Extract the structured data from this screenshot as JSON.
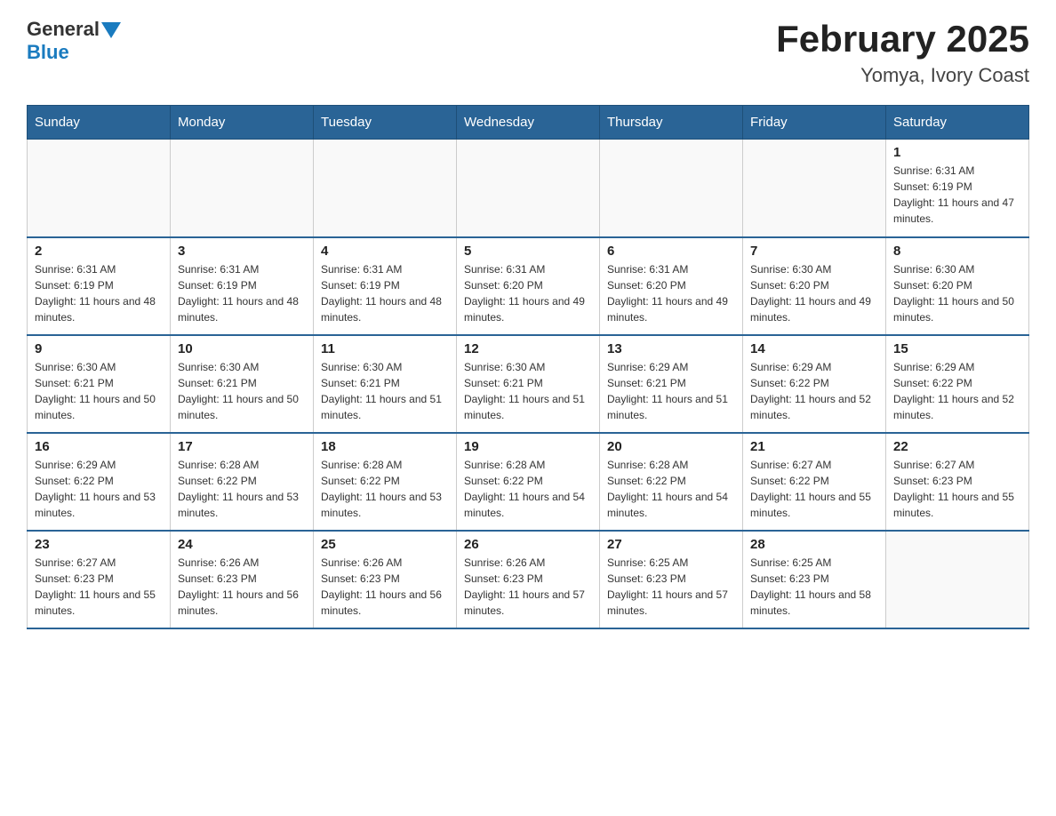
{
  "header": {
    "logo": {
      "general": "General",
      "arrow": "▲",
      "blue": "Blue"
    },
    "title": "February 2025",
    "location": "Yomya, Ivory Coast"
  },
  "weekdays": [
    "Sunday",
    "Monday",
    "Tuesday",
    "Wednesday",
    "Thursday",
    "Friday",
    "Saturday"
  ],
  "weeks": [
    [
      {
        "day": "",
        "info": ""
      },
      {
        "day": "",
        "info": ""
      },
      {
        "day": "",
        "info": ""
      },
      {
        "day": "",
        "info": ""
      },
      {
        "day": "",
        "info": ""
      },
      {
        "day": "",
        "info": ""
      },
      {
        "day": "1",
        "info": "Sunrise: 6:31 AM\nSunset: 6:19 PM\nDaylight: 11 hours and 47 minutes."
      }
    ],
    [
      {
        "day": "2",
        "info": "Sunrise: 6:31 AM\nSunset: 6:19 PM\nDaylight: 11 hours and 48 minutes."
      },
      {
        "day": "3",
        "info": "Sunrise: 6:31 AM\nSunset: 6:19 PM\nDaylight: 11 hours and 48 minutes."
      },
      {
        "day": "4",
        "info": "Sunrise: 6:31 AM\nSunset: 6:19 PM\nDaylight: 11 hours and 48 minutes."
      },
      {
        "day": "5",
        "info": "Sunrise: 6:31 AM\nSunset: 6:20 PM\nDaylight: 11 hours and 49 minutes."
      },
      {
        "day": "6",
        "info": "Sunrise: 6:31 AM\nSunset: 6:20 PM\nDaylight: 11 hours and 49 minutes."
      },
      {
        "day": "7",
        "info": "Sunrise: 6:30 AM\nSunset: 6:20 PM\nDaylight: 11 hours and 49 minutes."
      },
      {
        "day": "8",
        "info": "Sunrise: 6:30 AM\nSunset: 6:20 PM\nDaylight: 11 hours and 50 minutes."
      }
    ],
    [
      {
        "day": "9",
        "info": "Sunrise: 6:30 AM\nSunset: 6:21 PM\nDaylight: 11 hours and 50 minutes."
      },
      {
        "day": "10",
        "info": "Sunrise: 6:30 AM\nSunset: 6:21 PM\nDaylight: 11 hours and 50 minutes."
      },
      {
        "day": "11",
        "info": "Sunrise: 6:30 AM\nSunset: 6:21 PM\nDaylight: 11 hours and 51 minutes."
      },
      {
        "day": "12",
        "info": "Sunrise: 6:30 AM\nSunset: 6:21 PM\nDaylight: 11 hours and 51 minutes."
      },
      {
        "day": "13",
        "info": "Sunrise: 6:29 AM\nSunset: 6:21 PM\nDaylight: 11 hours and 51 minutes."
      },
      {
        "day": "14",
        "info": "Sunrise: 6:29 AM\nSunset: 6:22 PM\nDaylight: 11 hours and 52 minutes."
      },
      {
        "day": "15",
        "info": "Sunrise: 6:29 AM\nSunset: 6:22 PM\nDaylight: 11 hours and 52 minutes."
      }
    ],
    [
      {
        "day": "16",
        "info": "Sunrise: 6:29 AM\nSunset: 6:22 PM\nDaylight: 11 hours and 53 minutes."
      },
      {
        "day": "17",
        "info": "Sunrise: 6:28 AM\nSunset: 6:22 PM\nDaylight: 11 hours and 53 minutes."
      },
      {
        "day": "18",
        "info": "Sunrise: 6:28 AM\nSunset: 6:22 PM\nDaylight: 11 hours and 53 minutes."
      },
      {
        "day": "19",
        "info": "Sunrise: 6:28 AM\nSunset: 6:22 PM\nDaylight: 11 hours and 54 minutes."
      },
      {
        "day": "20",
        "info": "Sunrise: 6:28 AM\nSunset: 6:22 PM\nDaylight: 11 hours and 54 minutes."
      },
      {
        "day": "21",
        "info": "Sunrise: 6:27 AM\nSunset: 6:22 PM\nDaylight: 11 hours and 55 minutes."
      },
      {
        "day": "22",
        "info": "Sunrise: 6:27 AM\nSunset: 6:23 PM\nDaylight: 11 hours and 55 minutes."
      }
    ],
    [
      {
        "day": "23",
        "info": "Sunrise: 6:27 AM\nSunset: 6:23 PM\nDaylight: 11 hours and 55 minutes."
      },
      {
        "day": "24",
        "info": "Sunrise: 6:26 AM\nSunset: 6:23 PM\nDaylight: 11 hours and 56 minutes."
      },
      {
        "day": "25",
        "info": "Sunrise: 6:26 AM\nSunset: 6:23 PM\nDaylight: 11 hours and 56 minutes."
      },
      {
        "day": "26",
        "info": "Sunrise: 6:26 AM\nSunset: 6:23 PM\nDaylight: 11 hours and 57 minutes."
      },
      {
        "day": "27",
        "info": "Sunrise: 6:25 AM\nSunset: 6:23 PM\nDaylight: 11 hours and 57 minutes."
      },
      {
        "day": "28",
        "info": "Sunrise: 6:25 AM\nSunset: 6:23 PM\nDaylight: 11 hours and 58 minutes."
      },
      {
        "day": "",
        "info": ""
      }
    ]
  ]
}
